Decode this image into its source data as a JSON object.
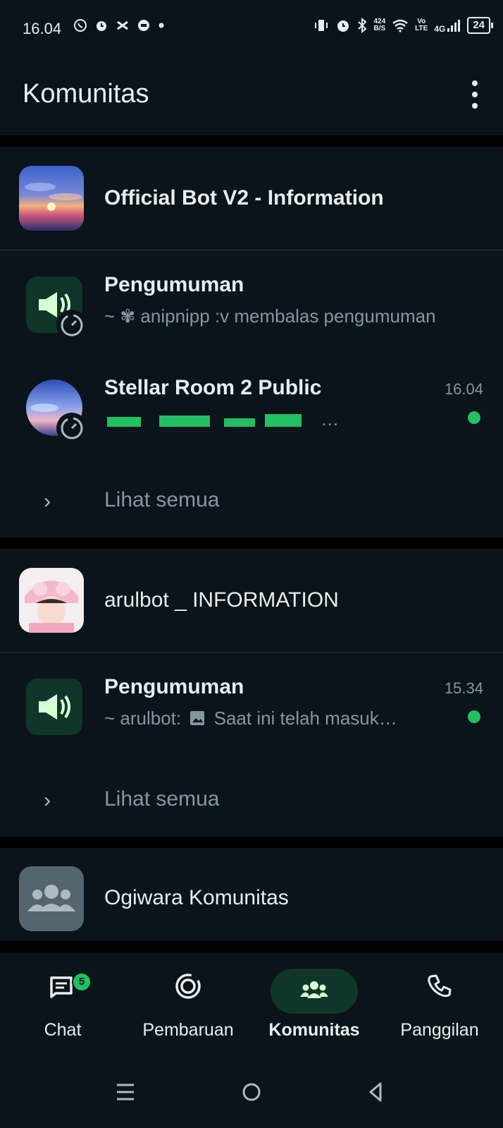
{
  "status_bar": {
    "time": "16.04",
    "net_speed_top": "424",
    "net_speed_bottom": "B/S",
    "volte_top": "Vo",
    "volte_bottom": "LTE",
    "network": "4G",
    "battery": "24"
  },
  "app_bar": {
    "title": "Komunitas"
  },
  "communities": [
    {
      "name": "Official Bot V2 - Information",
      "groups": [
        {
          "title": "Pengumuman",
          "subtitle": "~ ✾ anipnipp :v membalas pengumuman",
          "time": ""
        },
        {
          "title": "Stellar Room 2 Public",
          "subtitle": "…",
          "time": "16.04",
          "unread": true
        }
      ],
      "see_all": "Lihat semua"
    },
    {
      "name": "arulbot _ INFORMATION",
      "groups": [
        {
          "title": "Pengumuman",
          "subtitle_sender": "~ arulbot:",
          "subtitle_text": "Saat ini telah masuk…",
          "time": "15.34",
          "unread": true
        }
      ],
      "see_all": "Lihat semua"
    },
    {
      "name": "Ogiwara Komunitas"
    }
  ],
  "bottom_nav": {
    "chat": {
      "label": "Chat",
      "badge": "5"
    },
    "updates": {
      "label": "Pembaruan"
    },
    "communities": {
      "label": "Komunitas"
    },
    "calls": {
      "label": "Panggilan"
    }
  },
  "colors": {
    "accent": "#21c063",
    "background": "#0b141a",
    "pill": "#103529",
    "secondary_text": "#8696a0"
  }
}
